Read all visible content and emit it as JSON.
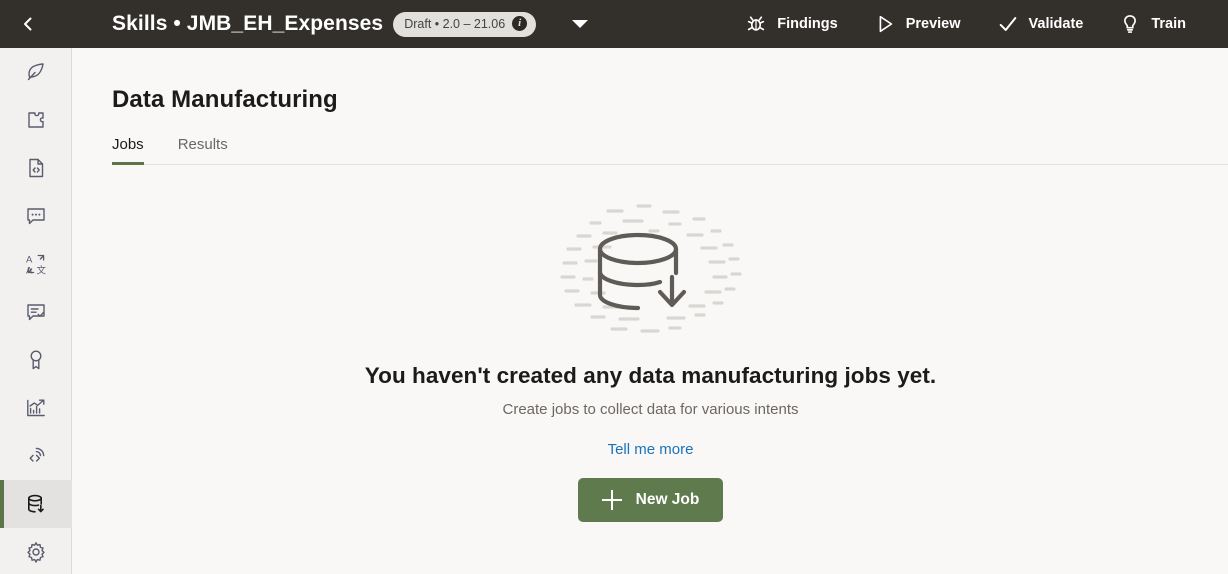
{
  "header": {
    "back_icon": "chevron-left-icon",
    "title": "Skills • JMB_EH_Expenses",
    "badge": {
      "text": "Draft • 2.0 – 21.06",
      "info_glyph": "i",
      "info_icon": "info-icon"
    },
    "dropdown_icon": "chevron-down-icon",
    "actions": [
      {
        "label": "Findings",
        "icon": "bug-icon"
      },
      {
        "label": "Preview",
        "icon": "play-icon"
      },
      {
        "label": "Validate",
        "icon": "check-icon"
      },
      {
        "label": "Train",
        "icon": "lightbulb-icon"
      }
    ]
  },
  "sidebar": {
    "items": [
      {
        "name": "sidebar-item-authoring",
        "icon": "feather-icon",
        "active": false
      },
      {
        "name": "sidebar-item-extensions",
        "icon": "puzzle-piece-icon",
        "active": false
      },
      {
        "name": "sidebar-item-source-code",
        "icon": "code-document-icon",
        "active": false
      },
      {
        "name": "sidebar-item-conversations",
        "icon": "chat-bubble-icon",
        "active": false
      },
      {
        "name": "sidebar-item-language",
        "icon": "translate-icon",
        "active": false
      },
      {
        "name": "sidebar-item-feedback",
        "icon": "chat-check-icon",
        "active": false
      },
      {
        "name": "sidebar-item-quality",
        "icon": "award-ribbon-icon",
        "active": false
      },
      {
        "name": "sidebar-item-insights",
        "icon": "analytics-chart-icon",
        "active": false
      },
      {
        "name": "sidebar-item-api",
        "icon": "code-broadcast-icon",
        "active": false
      },
      {
        "name": "sidebar-item-data-manufacturing",
        "icon": "database-download-icon",
        "active": true
      },
      {
        "name": "sidebar-item-settings",
        "icon": "gear-icon",
        "active": false
      }
    ]
  },
  "main": {
    "page_title": "Data Manufacturing",
    "tabs": [
      {
        "label": "Jobs",
        "active": true
      },
      {
        "label": "Results",
        "active": false
      }
    ],
    "empty_state": {
      "illustration_icon": "database-download-illustration",
      "heading": "You haven't created any data manufacturing jobs yet.",
      "subtext": "Create jobs to collect data for various intents",
      "link_label": "Tell me more",
      "button_label": "New Job",
      "button_icon": "plus-icon"
    }
  },
  "colors": {
    "header_bg": "#332f2b",
    "rail_bg": "#f2f1f0",
    "content_bg": "#f9f8f7",
    "accent_green": "#5d7448",
    "button_green": "#5f7a4c",
    "link_blue": "#1a73b8",
    "text_primary": "#1d1b19",
    "text_muted": "#6d6762"
  }
}
